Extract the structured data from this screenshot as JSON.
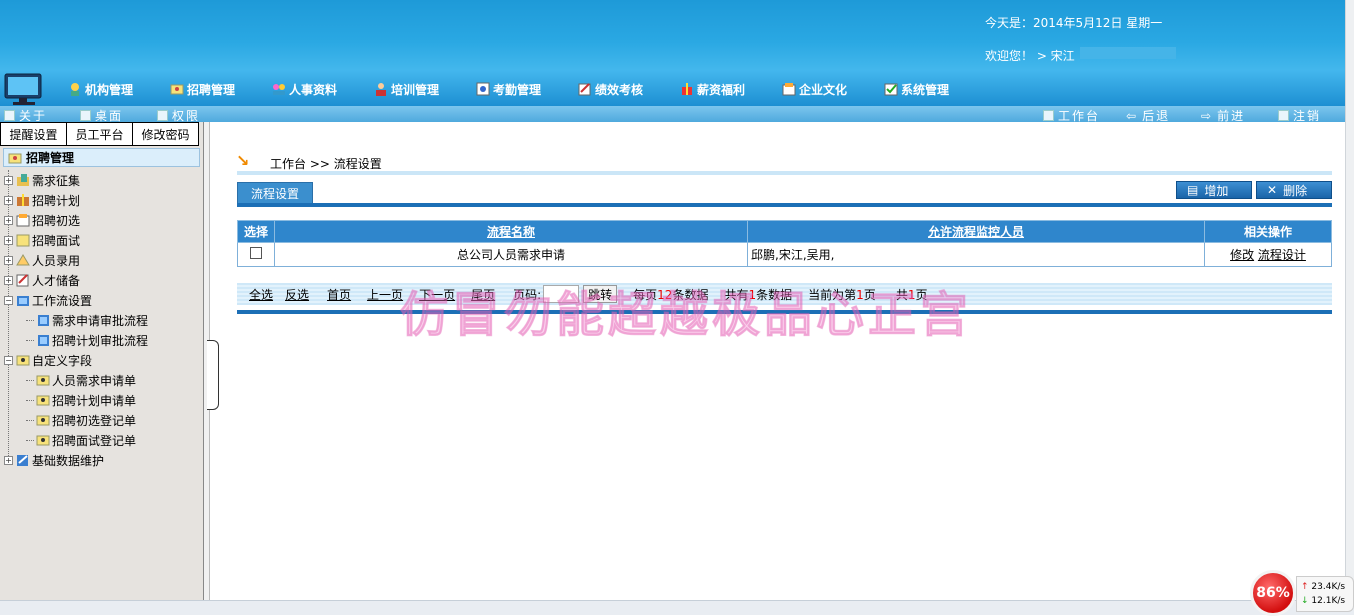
{
  "header": {
    "date_text": "今天是：2014年5月12日   星期一",
    "welcome_text": "欢迎您！ > 宋江"
  },
  "nav": {
    "items": [
      {
        "label": "机构管理",
        "icon": "org-icon"
      },
      {
        "label": "招聘管理",
        "icon": "recruit-icon"
      },
      {
        "label": "人事资料",
        "icon": "people-icon"
      },
      {
        "label": "培训管理",
        "icon": "training-icon"
      },
      {
        "label": "考勤管理",
        "icon": "attendance-icon"
      },
      {
        "label": "绩效考核",
        "icon": "performance-icon"
      },
      {
        "label": "薪资福利",
        "icon": "salary-icon"
      },
      {
        "label": "企业文化",
        "icon": "culture-icon"
      },
      {
        "label": "系统管理",
        "icon": "system-icon"
      }
    ]
  },
  "subbar": {
    "about": "关于",
    "desktop": "桌面",
    "permission": "权限",
    "workbench": "工作台",
    "back": "后退",
    "forward": "前进",
    "logout": "注销"
  },
  "left": {
    "tabs": [
      "提醒设置",
      "员工平台",
      "修改密码"
    ],
    "tree_title": "招聘管理",
    "tree": [
      {
        "label": "需求征集",
        "level": 0
      },
      {
        "label": "招聘计划",
        "level": 0
      },
      {
        "label": "招聘初选",
        "level": 0
      },
      {
        "label": "招聘面试",
        "level": 0
      },
      {
        "label": "人员录用",
        "level": 0
      },
      {
        "label": "人才储备",
        "level": 0
      },
      {
        "label": "工作流设置",
        "level": 0
      },
      {
        "label": "需求申请审批流程",
        "level": 1
      },
      {
        "label": "招聘计划审批流程",
        "level": 1
      },
      {
        "label": "自定义字段",
        "level": 0
      },
      {
        "label": "人员需求申请单",
        "level": 1
      },
      {
        "label": "招聘计划申请单",
        "level": 1
      },
      {
        "label": "招聘初选登记单",
        "level": 1
      },
      {
        "label": "招聘面试登记单",
        "level": 1
      },
      {
        "label": "基础数据维护",
        "level": 0
      }
    ]
  },
  "content": {
    "breadcrumb": "工作台 >> 流程设置",
    "section_title": "流程设置",
    "add_label": "增加",
    "delete_label": "删除",
    "table": {
      "headers": [
        "选择",
        "流程名称",
        "允许流程监控人员",
        "相关操作"
      ],
      "rows": [
        {
          "name": "总公司人员需求申请",
          "monitors": "邱鹏,宋江,吴用,",
          "edit": "修改",
          "design": "流程设计"
        }
      ]
    },
    "pager": {
      "select_all": "全选",
      "invert": "反选",
      "first": "首页",
      "prev": "上一页",
      "next": "下一页",
      "last": "尾页",
      "page_label": "页码:",
      "jump": "跳转",
      "per_page_prefix": "每页",
      "per_page_value": "12",
      "per_page_suffix": "条数据",
      "total_prefix": "共有",
      "total_value": "1",
      "total_suffix": "条数据",
      "current_prefix": "当前为第",
      "current_value": "1",
      "current_suffix": "页",
      "pages_prefix": "共",
      "pages_value": "1",
      "pages_suffix": "页"
    },
    "watermark": "仿冒勿能超越极品心正宫"
  },
  "tray": {
    "meter": "86%",
    "up_speed": "23.4K/s",
    "down_speed": "12.1K/s"
  },
  "colors": {
    "header": "#2aa8e3",
    "table_header": "#2f86cc",
    "accent_red": "#e00000"
  }
}
